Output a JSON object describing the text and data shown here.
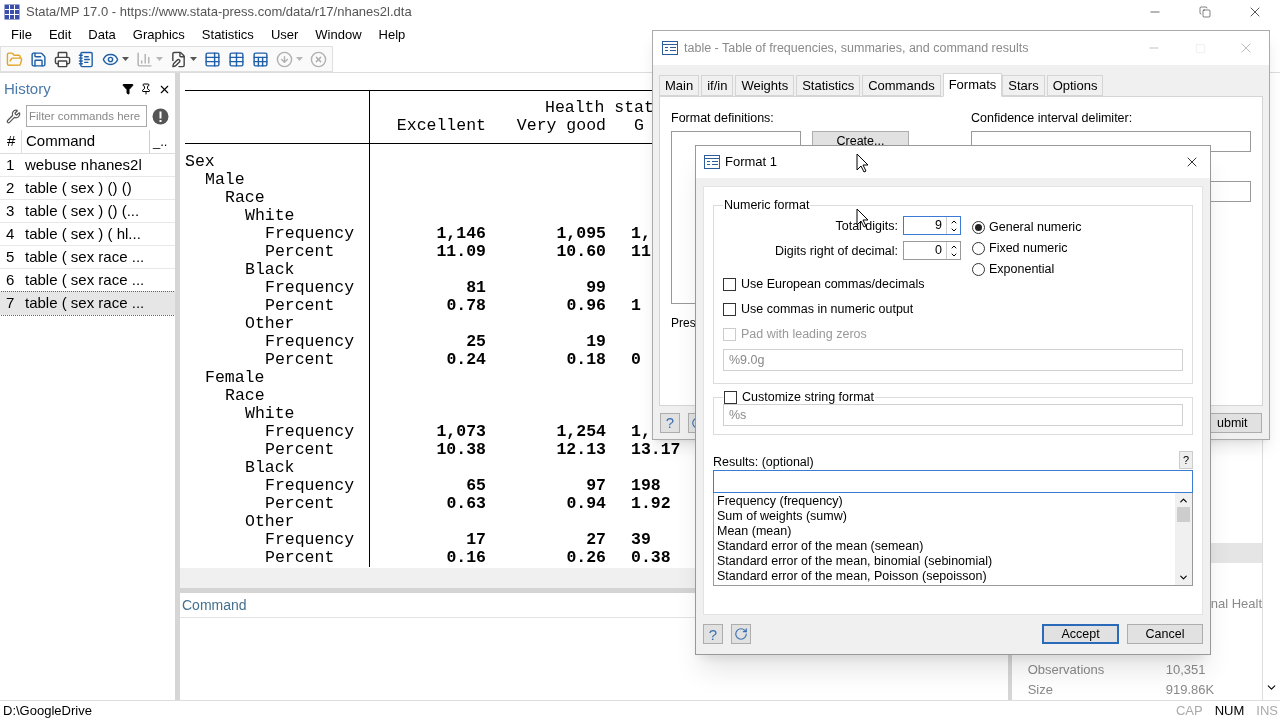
{
  "window": {
    "title": "Stata/MP 17.0 - https://www.stata-press.com/data/r17/nhanes2l.dta"
  },
  "menu": [
    "File",
    "Edit",
    "Data",
    "Graphics",
    "Statistics",
    "User",
    "Window",
    "Help"
  ],
  "toolbar": [
    {
      "kind": "open",
      "disabled": false,
      "dropdown": false
    },
    {
      "kind": "save",
      "disabled": false,
      "dropdown": false
    },
    {
      "kind": "print",
      "disabled": false,
      "dropdown": false
    },
    {
      "kind": "log",
      "disabled": false,
      "dropdown": false
    },
    {
      "kind": "viewer",
      "disabled": false,
      "dropdown": true
    },
    {
      "kind": "graph",
      "disabled": true,
      "dropdown": true
    },
    {
      "kind": "dofile",
      "disabled": false,
      "dropdown": true
    },
    {
      "kind": "editor",
      "disabled": false,
      "dropdown": false
    },
    {
      "kind": "browser",
      "disabled": false,
      "dropdown": false
    },
    {
      "kind": "variables",
      "disabled": false,
      "dropdown": false
    },
    {
      "kind": "more",
      "disabled": true,
      "dropdown": true
    },
    {
      "kind": "break",
      "disabled": true,
      "dropdown": false
    }
  ],
  "history": {
    "title": "History",
    "filter_placeholder": "Filter commands here",
    "columns": [
      "#",
      "Command",
      "_.."
    ],
    "rows": [
      {
        "number": "1",
        "command": "webuse nhanes2l",
        "selected": false
      },
      {
        "number": "2",
        "command": "table ( sex ) () ()",
        "selected": false
      },
      {
        "number": "3",
        "command": "table ( sex ) () (...",
        "selected": false
      },
      {
        "number": "4",
        "command": "table ( sex ) ( hl...",
        "selected": false
      },
      {
        "number": "5",
        "command": "table ( sex race ...",
        "selected": false
      },
      {
        "number": "6",
        "command": "table ( sex race ...",
        "selected": false
      },
      {
        "number": "7",
        "command": "table ( sex race ...",
        "selected": true
      }
    ]
  },
  "results": {
    "header": {
      "title": "Health stat",
      "columns": [
        "Excellent",
        "Very good",
        "G"
      ]
    },
    "rows": [
      {
        "label": "Sex",
        "children": [
          {
            "label": "Male",
            "children": [
              {
                "label": "Race",
                "children": [
                  {
                    "label": "White",
                    "children": [
                      {
                        "label": "Frequency",
                        "values": [
                          "1,146",
                          "1,095",
                          "1,"
                        ]
                      },
                      {
                        "label": "Percent",
                        "values": [
                          "11.09",
                          "10.60",
                          "11"
                        ]
                      }
                    ]
                  },
                  {
                    "label": "Black",
                    "children": [
                      {
                        "label": "Frequency",
                        "values": [
                          "81",
                          "99"
                        ]
                      },
                      {
                        "label": "Percent",
                        "values": [
                          "0.78",
                          "0.96",
                          "1"
                        ]
                      }
                    ]
                  },
                  {
                    "label": "Other",
                    "children": [
                      {
                        "label": "Frequency",
                        "values": [
                          "25",
                          "19"
                        ]
                      },
                      {
                        "label": "Percent",
                        "values": [
                          "0.24",
                          "0.18",
                          "0"
                        ]
                      }
                    ]
                  }
                ]
              }
            ]
          },
          {
            "label": "Female",
            "children": [
              {
                "label": "Race",
                "children": [
                  {
                    "label": "White",
                    "children": [
                      {
                        "label": "Frequency",
                        "values": [
                          "1,073",
                          "1,254",
                          "1,"
                        ]
                      },
                      {
                        "label": "Percent",
                        "values": [
                          "10.38",
                          "12.13",
                          "13.17"
                        ]
                      }
                    ]
                  },
                  {
                    "label": "Black",
                    "children": [
                      {
                        "label": "Frequency",
                        "values": [
                          "65",
                          "97",
                          "198"
                        ]
                      },
                      {
                        "label": "Percent",
                        "values": [
                          "0.63",
                          "0.94",
                          "1.92"
                        ]
                      }
                    ]
                  },
                  {
                    "label": "Other",
                    "children": [
                      {
                        "label": "Frequency",
                        "values": [
                          "17",
                          "27",
                          "39"
                        ]
                      },
                      {
                        "label": "Percent",
                        "values": [
                          "0.16",
                          "0.26",
                          "0.38"
                        ]
                      }
                    ]
                  }
                ]
              }
            ]
          }
        ]
      }
    ]
  },
  "command": {
    "label": "Command"
  },
  "properties": {
    "cut_value": "nal Healt",
    "rows": [
      {
        "label": "Observations",
        "value": "10,351"
      },
      {
        "label": "Size",
        "value": "919.86K"
      }
    ]
  },
  "status_bar": {
    "path": "D:\\GoogleDrive",
    "indicators": [
      {
        "label": "CAP",
        "on": false
      },
      {
        "label": "NUM",
        "on": true
      },
      {
        "label": "INS",
        "on": false
      }
    ]
  },
  "table_dialog": {
    "title": "table - Table of frequencies, summaries, and command results",
    "tabs": [
      {
        "label": "Main",
        "selected": false
      },
      {
        "label": "if/in",
        "selected": false
      },
      {
        "label": "Weights",
        "selected": false
      },
      {
        "label": "Statistics",
        "selected": false
      },
      {
        "label": "Commands",
        "selected": false
      },
      {
        "label": "Formats",
        "selected": true
      },
      {
        "label": "Stars",
        "selected": false
      },
      {
        "label": "Options",
        "selected": false
      }
    ],
    "format_definitions_label": "Format definitions:",
    "create_button": "Create...",
    "ci_delimiter_label": "Confidence interval delimiter:",
    "cut_label": "Pres",
    "help_button": "?",
    "submit_button": "ubmit"
  },
  "format_dialog": {
    "title": "Format 1",
    "numeric_group": "Numeric format",
    "total_digits": {
      "label": "Total digits:",
      "value": "9"
    },
    "decimal_digits": {
      "label": "Digits right of decimal:",
      "value": "0"
    },
    "radios": [
      {
        "label": "General numeric",
        "selected": true
      },
      {
        "label": "Fixed numeric",
        "selected": false
      },
      {
        "label": "Exponential",
        "selected": false
      }
    ],
    "checkboxes": [
      {
        "label": "Use European commas/decimals",
        "checked": false,
        "disabled": false
      },
      {
        "label": "Use commas in numeric output",
        "checked": false,
        "disabled": false
      },
      {
        "label": "Pad with leading zeros",
        "checked": false,
        "disabled": true
      }
    ],
    "numeric_format_value": "%9.0g",
    "string_format": {
      "label": "Customize string format",
      "checked": false,
      "value": "%s"
    },
    "results_label": "Results: (optional)",
    "results_help": "?",
    "results_options": [
      "Frequency (frequency)",
      "Sum of weights (sumw)",
      "Mean (mean)",
      "Standard error of the mean (semean)",
      "Standard error of the mean, binomial (sebinomial)",
      "Standard error of the mean, Poisson (sepoisson)"
    ],
    "help_button": "?",
    "accept_button": "Accept",
    "cancel_button": "Cancel"
  }
}
